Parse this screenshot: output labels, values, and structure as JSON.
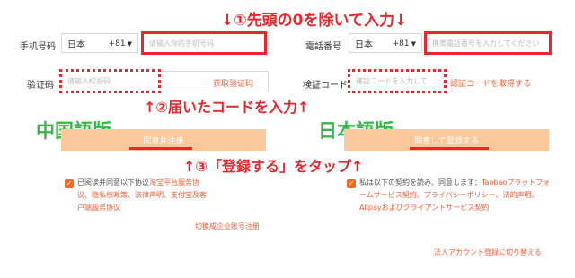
{
  "annotations": {
    "step1": "↓①先頭の0を除いて入力↓",
    "step2": "↑②届いたコードを入力↑",
    "step3": "↑③「登録する」をタップ↑"
  },
  "chinese": {
    "tag": "中国語版",
    "phone_label": "手机号码",
    "country": "日本",
    "country_code": "+81",
    "phone_placeholder": "请输入你的手机号码",
    "code_label": "验证码",
    "code_placeholder": "请输入校验码",
    "get_code": "获取验证码",
    "register_button": "同意并注册",
    "agreement_prefix": "已阅读并同意以下协议",
    "agreement_links": "淘宝平台服务协议、隐私权政策、法律声明、支付宝及客户端服务协议",
    "switch_corporate": "切换成企业账号注册"
  },
  "japanese": {
    "tag": "日本語版",
    "phone_label": "電話番号",
    "country": "日本",
    "country_code": "+81",
    "phone_placeholder": "携帯電話番号を入力してください",
    "code_label": "検証コード",
    "code_placeholder": "確認コードを入力して",
    "get_code": "認証コードを取得する",
    "register_button": "同意して登録する",
    "agreement_prefix": "私は以下の契約を読み、同意します：",
    "agreement_links": "Taobaoプラットフォームサービス契約、プライバシーポリシー、法的声明、Alipayおよびクライアントサービス契約",
    "switch_corporate": "法人アカウント登録に切り替える"
  },
  "colors": {
    "annotation_red": "#e8262d",
    "tag_green": "#3ab54a",
    "orange": "#f1603b",
    "button_fill": "#fcc79a"
  }
}
